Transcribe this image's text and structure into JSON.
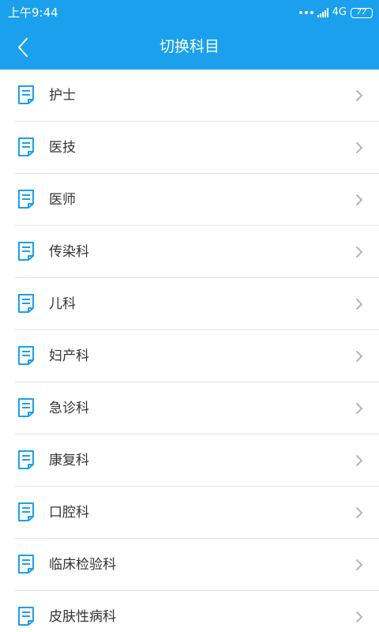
{
  "status_bar": {
    "time": "上午9:44",
    "network": "4G",
    "battery": "77"
  },
  "header": {
    "title": "切换科目",
    "back_icon": "chevron-left-icon"
  },
  "colors": {
    "primary": "#1aa0ec",
    "icon": "#1aa0ec",
    "text": "#333333",
    "divider": "#e3e3e3",
    "chevron": "#b5b5b5"
  },
  "subjects": [
    {
      "label": "护士",
      "icon": "document-icon"
    },
    {
      "label": "医技",
      "icon": "document-icon"
    },
    {
      "label": "医师",
      "icon": "document-icon"
    },
    {
      "label": "传染科",
      "icon": "document-icon"
    },
    {
      "label": "儿科",
      "icon": "document-icon"
    },
    {
      "label": "妇产科",
      "icon": "document-icon"
    },
    {
      "label": "急诊科",
      "icon": "document-icon"
    },
    {
      "label": "康复科",
      "icon": "document-icon"
    },
    {
      "label": "口腔科",
      "icon": "document-icon"
    },
    {
      "label": "临床检验科",
      "icon": "document-icon"
    },
    {
      "label": "皮肤性病科",
      "icon": "document-icon"
    }
  ]
}
